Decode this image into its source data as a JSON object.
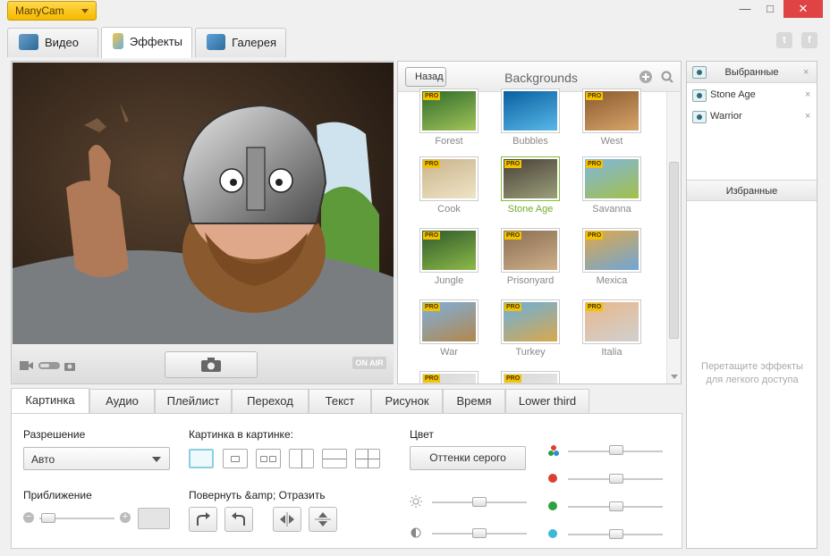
{
  "app": {
    "name": "ManyCam"
  },
  "window": {
    "minimize": "—",
    "maximize": "□",
    "close": "✕"
  },
  "main_tabs": [
    {
      "label": "Видео",
      "icon": "video-icon"
    },
    {
      "label": "Эффекты",
      "icon": "effects-icon",
      "active": true
    },
    {
      "label": "Галерея",
      "icon": "gallery-icon"
    }
  ],
  "social": {
    "twitter": "t",
    "facebook": "f"
  },
  "video": {
    "on_air": "ON AIR"
  },
  "backgrounds": {
    "back_label": "Назад",
    "title": "Backgrounds",
    "items": [
      {
        "label": "Forest",
        "pro": "PRO",
        "colors": [
          "#2f6b2a",
          "#a3c45a"
        ]
      },
      {
        "label": "Bubbles",
        "pro": "",
        "colors": [
          "#0a5fa0",
          "#58b8e8"
        ]
      },
      {
        "label": "West",
        "pro": "PRO",
        "colors": [
          "#8a5a2e",
          "#d7a46a"
        ]
      },
      {
        "label": "Cook",
        "pro": "PRO",
        "colors": [
          "#c9b48a",
          "#efe4c8"
        ]
      },
      {
        "label": "Stone Age",
        "pro": "PRO",
        "colors": [
          "#4a4038",
          "#9aa07a"
        ],
        "selected": true
      },
      {
        "label": "Savanna",
        "pro": "PRO",
        "colors": [
          "#7fb6e0",
          "#a3c04a"
        ]
      },
      {
        "label": "Jungle",
        "pro": "PRO",
        "colors": [
          "#2e5a2a",
          "#8db94a"
        ]
      },
      {
        "label": "Prisonyard",
        "pro": "PRO",
        "colors": [
          "#8b6d52",
          "#cdb08a"
        ]
      },
      {
        "label": "Mexica",
        "pro": "PRO",
        "colors": [
          "#e0a848",
          "#6fa6d8"
        ]
      },
      {
        "label": "War",
        "pro": "PRO",
        "colors": [
          "#7eb0dc",
          "#b2874e"
        ]
      },
      {
        "label": "Turkey",
        "pro": "PRO",
        "colors": [
          "#6ab0e0",
          "#d9a84a"
        ]
      },
      {
        "label": "Italia",
        "pro": "PRO",
        "colors": [
          "#e8b88a",
          "#d0d0d0"
        ]
      },
      {
        "label": "",
        "pro": "PRO",
        "colors": [
          "#d8d8d8",
          "#f0f0f0"
        ]
      },
      {
        "label": "",
        "pro": "PRO",
        "colors": [
          "#d8d8d8",
          "#f0f0f0"
        ]
      }
    ]
  },
  "favorites": {
    "selected_title": "Выбранные",
    "selected_items": [
      {
        "label": "Stone Age",
        "remove": "×"
      },
      {
        "label": "Warrior",
        "remove": "×"
      }
    ],
    "close": "×",
    "fav_title": "Избранные",
    "drag_hint": "Перетащите эффекты для легкого доступа"
  },
  "bottom_tabs": [
    "Картинка",
    "Аудио",
    "Плейлист",
    "Переход",
    "Текст",
    "Рисунок",
    "Время",
    "Lower third"
  ],
  "picture": {
    "resolution_label": "Разрешение",
    "resolution_value": "Авто",
    "zoom_label": "Приближение",
    "zoom_minus": "−",
    "zoom_plus": "+",
    "pip_label": "Картинка в картинке:",
    "rotate_label": "Повернуть &amp; Отразить",
    "color_label": "Цвет",
    "grayscale_label": "Оттенки серого"
  }
}
